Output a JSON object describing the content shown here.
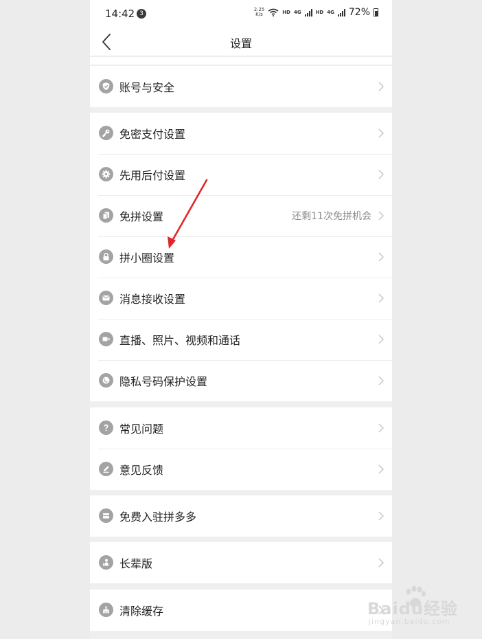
{
  "status_bar": {
    "time": "14:42",
    "notification_count": "3",
    "net_speed_value": "2.25",
    "net_speed_unit": "K/s",
    "hd1": "HD",
    "gen1": "4G",
    "hd2": "HD",
    "gen2": "4G",
    "battery": "72%"
  },
  "header": {
    "title": "设置",
    "back_icon": "chevron-left-icon"
  },
  "groups": [
    {
      "items": [
        {
          "label": "账号与安全",
          "icon": "shield-icon"
        }
      ]
    },
    {
      "items": [
        {
          "label": "免密支付设置",
          "icon": "key-icon"
        },
        {
          "label": "先用后付设置",
          "icon": "gear-icon"
        },
        {
          "label": "免拼设置",
          "icon": "cards-icon",
          "sub": "还剩11次免拼机会"
        },
        {
          "label": "拼小圈设置",
          "icon": "lock-icon"
        },
        {
          "label": "消息接收设置",
          "icon": "envelope-icon"
        },
        {
          "label": "直播、照片、视频和通话",
          "icon": "video-camera-icon"
        },
        {
          "label": "隐私号码保护设置",
          "icon": "phone-icon"
        }
      ]
    },
    {
      "items": [
        {
          "label": "常见问题",
          "icon": "question-icon"
        },
        {
          "label": "意见反馈",
          "icon": "pencil-icon"
        }
      ]
    },
    {
      "items": [
        {
          "label": "免费入驻拼多多",
          "icon": "store-icon"
        }
      ]
    },
    {
      "items": [
        {
          "label": "长辈版",
          "icon": "elder-icon"
        }
      ]
    },
    {
      "items": [
        {
          "label": "清除缓存",
          "icon": "broom-icon"
        }
      ]
    }
  ],
  "watermark": {
    "text": "Baidu经验",
    "sub": "jingyan.baidu.com"
  },
  "colors": {
    "background": "#efefef",
    "card": "#ffffff",
    "icon_bg": "#a3a3a3",
    "annotation_arrow": "#e0262b"
  }
}
